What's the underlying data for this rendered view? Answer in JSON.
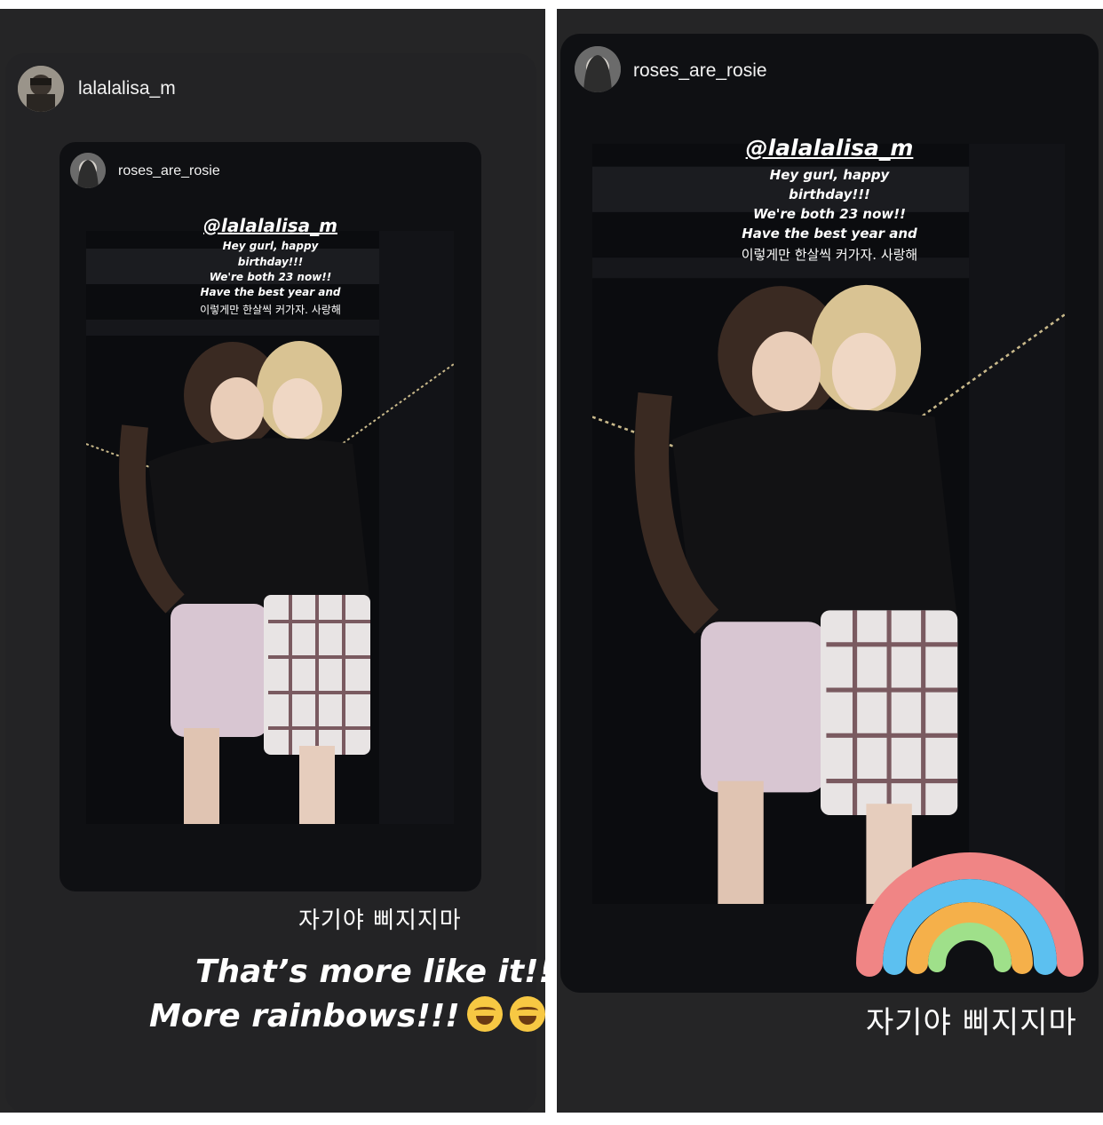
{
  "left_story": {
    "poster": "lalalalisa_m",
    "shared_story": {
      "poster": "roses_are_rosie",
      "mention": "@lalalalisa_m",
      "message_lines": [
        "Hey gurl, happy",
        "birthday!!!",
        "We're both 23 now!!",
        "Have the best year and"
      ],
      "message_korean": "이렇게만 한살씩 커가자. 사랑해"
    },
    "caption_korean": "자기야 삐지지마",
    "caption_line1": "That’s more like it!!",
    "caption_line2": "More rainbows!!!",
    "emoji_icon": "laughing-tears-emoji"
  },
  "right_story": {
    "poster": "roses_are_rosie",
    "mention": "@lalalalisa_m",
    "message_lines": [
      "Hey gurl, happy",
      "birthday!!!",
      "We're both 23 now!!",
      "Have the best year and"
    ],
    "message_korean": "이렇게만 한살씩 커가자. 사랑해",
    "caption_korean": "자기야 삐지지마",
    "sticker_icon": "rainbow-sticker",
    "rainbow_colors": [
      "#f08585",
      "#5cc0f0",
      "#f5b04a",
      "#9fe08a"
    ]
  }
}
